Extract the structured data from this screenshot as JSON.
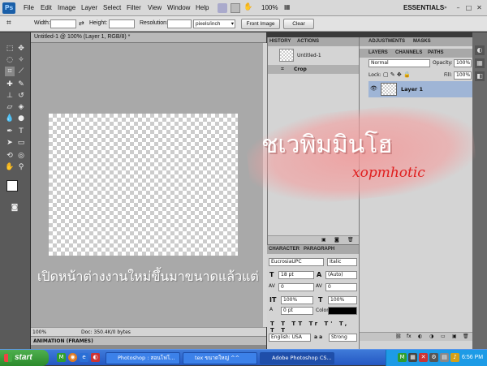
{
  "app": {
    "logo": "Ps",
    "zoom": "100%",
    "workspace": "ESSENTIALS"
  },
  "menu": [
    "File",
    "Edit",
    "Image",
    "Layer",
    "Select",
    "Filter",
    "View",
    "Window",
    "Help"
  ],
  "window_controls": [
    "–",
    "□",
    "✕"
  ],
  "options": {
    "width_label": "Width:",
    "height_label": "Height:",
    "resolution_label": "Resolution:",
    "units_value": "pixels/inch",
    "front_image_label": "Front Image",
    "clear_label": "Clear"
  },
  "document": {
    "tab_title": "Untitled-1 @ 100% (Layer 1, RGB/8) *",
    "status_zoom": "100%",
    "doc_info": "Doc: 350.4K/0 bytes",
    "animation_label": "ANIMATION (FRAMES)"
  },
  "caption": "เปิดหน้าต่างงานใหม่ขึ้นมาขนาดแล้วแต่",
  "history": {
    "tabs": [
      "HISTORY",
      "ACTIONS"
    ],
    "snapshot_label": "Untitled-1",
    "step_label": "Crop"
  },
  "adjustments": {
    "tabs": [
      "ADJUSTMENTS",
      "MASKS"
    ]
  },
  "layers": {
    "tabs": [
      "LAYERS",
      "CHANNELS",
      "PATHS"
    ],
    "blend_mode": "Normal",
    "opacity_label": "Opacity:",
    "opacity": "100%",
    "lock_label": "Lock:",
    "fill_label": "Fill:",
    "fill": "100%",
    "layer_name": "Layer 1"
  },
  "character": {
    "tabs": [
      "CHARACTER",
      "PARAGRAPH"
    ],
    "font": "EucrosiaUPC",
    "style": "Italic",
    "size": "18 pt",
    "leading": "(Auto)",
    "kerning": "0",
    "tracking": "0",
    "vscale": "100%",
    "hscale": "100%",
    "baseline": "0 pt",
    "color_label": "Color:",
    "color": "#000000",
    "language": "English: USA",
    "aa_label": "a a",
    "antialias": "Strong"
  },
  "watermark": {
    "thai": "ชเวพิมมินโฮ",
    "latin": "xopmhotic",
    "brush_color": "#f4a0a0"
  },
  "taskbar": {
    "start_label": "start",
    "tasks": [
      "Photoshop : สอนโฟโ...",
      "tex ขนาดใหญ่ ^^",
      "Adobe Photoshop CS..."
    ],
    "clock": "6:56 PM"
  }
}
